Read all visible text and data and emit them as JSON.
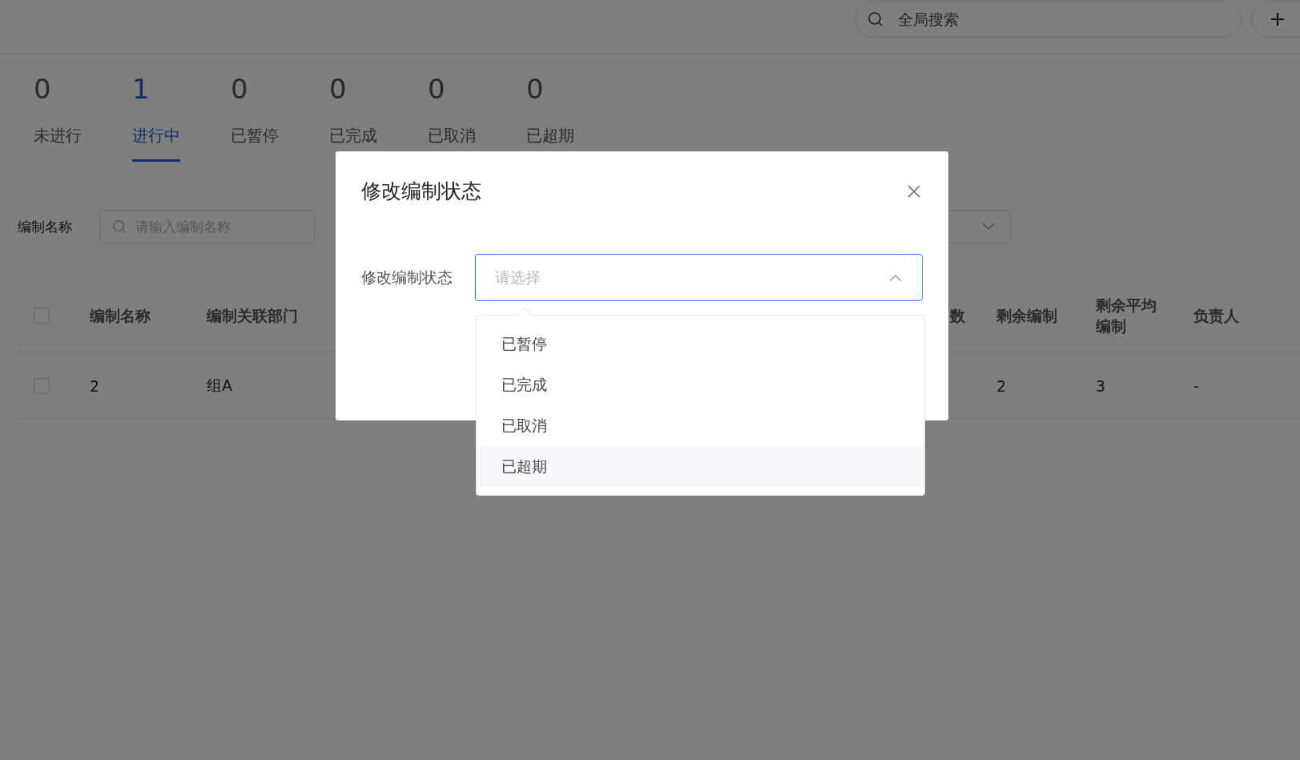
{
  "header": {
    "search": {
      "placeholder": "全局搜索"
    }
  },
  "status_tabs": [
    {
      "count": "0",
      "label": "未进行",
      "selected": false
    },
    {
      "count": "1",
      "label": "进行中",
      "selected": true
    },
    {
      "count": "0",
      "label": "已暂停",
      "selected": false
    },
    {
      "count": "0",
      "label": "已完成",
      "selected": false
    },
    {
      "count": "0",
      "label": "已取消",
      "selected": false
    },
    {
      "count": "0",
      "label": "已超期",
      "selected": false
    }
  ],
  "filter": {
    "label": "编制名称",
    "search": {
      "placeholder": "请输入编制名称"
    }
  },
  "table": {
    "columns": [
      {
        "label": "编制名称",
        "kind": "text"
      },
      {
        "label": "编制关联部门",
        "kind": "text"
      },
      {
        "kind": "hidden"
      },
      {
        "label": "数",
        "kind": "text"
      },
      {
        "label": "剩余编制",
        "kind": "text"
      },
      {
        "label": "剩余平均编制",
        "kind": "text"
      },
      {
        "label": "负责人",
        "kind": "text"
      }
    ],
    "rows": [
      {
        "checked": false,
        "cells": [
          "2",
          "组A",
          "",
          "",
          "2",
          "3",
          "-"
        ]
      }
    ],
    "header_checked": false
  },
  "dialog": {
    "title": "修改编制状态",
    "form_label": "修改编制状态",
    "select": {
      "placeholder": "请选择",
      "expanded": true
    },
    "options": [
      {
        "label": "已暂停",
        "hovered": false
      },
      {
        "label": "已完成",
        "hovered": false
      },
      {
        "label": "已取消",
        "hovered": false
      },
      {
        "label": "已超期",
        "hovered": true
      }
    ]
  }
}
